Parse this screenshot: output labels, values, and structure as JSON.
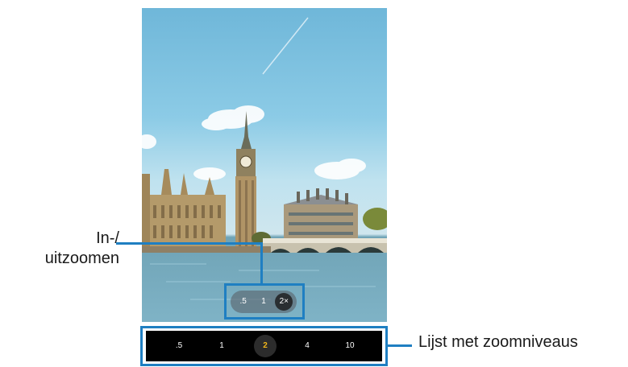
{
  "callouts": {
    "zoom_in_out": "In-/\nuitzoomen",
    "zoom_level_list": "Lijst met zoomniveaus"
  },
  "zoom_pill": {
    "options": [
      ".5",
      "1",
      "2×"
    ],
    "selected": "2×"
  },
  "zoom_list": {
    "levels": [
      ".5",
      "1",
      "2",
      "4",
      "10"
    ],
    "selected": "2"
  },
  "colors": {
    "callout_line": "#1f7fc2",
    "zoom_active_text": "#f2b71b",
    "bar_background": "#000000"
  }
}
